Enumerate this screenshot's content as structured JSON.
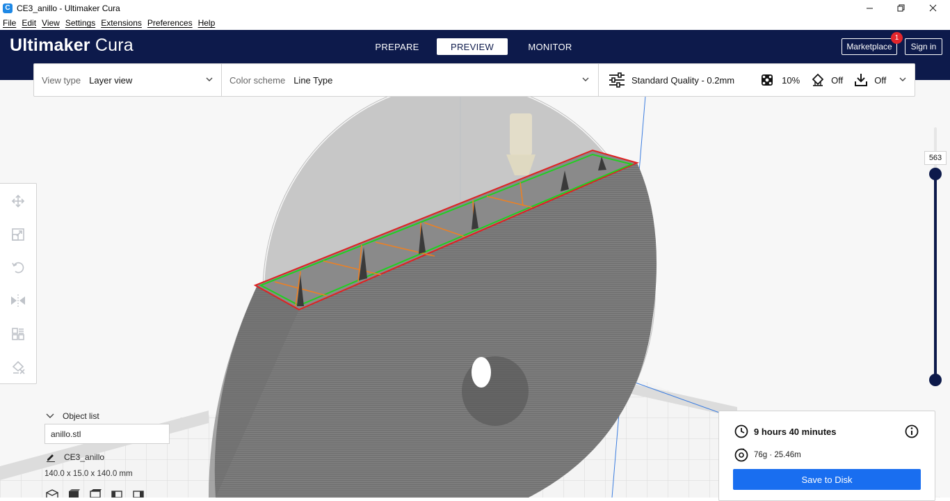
{
  "window": {
    "title": "CE3_anillo - Ultimaker Cura",
    "icon_letter": "C",
    "controls": [
      "minimize-icon",
      "restore-icon",
      "close-icon"
    ]
  },
  "menubar": {
    "items": [
      "File",
      "Edit",
      "View",
      "Settings",
      "Extensions",
      "Preferences",
      "Help"
    ]
  },
  "header": {
    "logo_light": "Ultimaker",
    "logo_bold": "Cura",
    "tabs": [
      {
        "label": "PREPARE",
        "active": false
      },
      {
        "label": "PREVIEW",
        "active": true
      },
      {
        "label": "MONITOR",
        "active": false
      }
    ],
    "marketplace_label": "Marketplace",
    "marketplace_badge": "1",
    "signin_label": "Sign in"
  },
  "toolbar": {
    "view_type_label": "View type",
    "view_type_value": "Layer view",
    "color_scheme_label": "Color scheme",
    "color_scheme_value": "Line Type",
    "quality": "Standard Quality - 0.2mm",
    "infill": "10%",
    "support": "Off",
    "adhesion": "Off"
  },
  "left_tools": [
    "move-icon",
    "scale-icon",
    "rotate-icon",
    "mirror-icon",
    "per-model-settings-icon",
    "support-blocker-icon"
  ],
  "layer_slider": {
    "current_layer": "563"
  },
  "object_list": {
    "header": "Object list",
    "item": "anillo.stl",
    "object_name": "CE3_anillo",
    "dimensions": "140.0 x 15.0 x 140.0 mm"
  },
  "print_info": {
    "time": "9 hours 40 minutes",
    "material": "76g · 25.46m",
    "save_label": "Save to Disk"
  },
  "colors": {
    "header_bg": "#0d1a4b",
    "accent": "#196ef0",
    "badge": "#e3262c",
    "outer_wall": "#e02020",
    "inner_wall": "#20d020",
    "infill": "#f08020"
  }
}
